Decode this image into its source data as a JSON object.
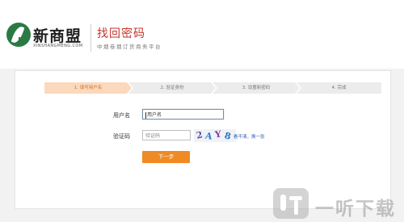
{
  "header": {
    "brand_name": "新商盟",
    "brand_sub": "XINSHANGMENG.COM",
    "page_title": "找回密码",
    "page_subtitle": "中烟卷烟订货商务平台"
  },
  "steps": [
    {
      "label": "1. 填写用户名",
      "state": "active"
    },
    {
      "label": "2. 验证身份",
      "state": "inactive"
    },
    {
      "label": "3. 设置新密码",
      "state": "inactive"
    },
    {
      "label": "4. 完成",
      "state": "inactive"
    }
  ],
  "form": {
    "username_label": "用户名",
    "username_placeholder": "用户名",
    "captcha_label": "验证码",
    "captcha_placeholder": "验证码",
    "captcha_chars": [
      "2",
      "A",
      "Y",
      "8"
    ],
    "refresh_link": "看不清，换一张",
    "next_button": "下一步"
  },
  "watermark": {
    "text": "一听下载"
  },
  "colors": {
    "accent": "#f08a24",
    "title_red": "#c8332b",
    "brand_green": "#2a7a44",
    "step_active_bg": "#fbd9bd"
  }
}
